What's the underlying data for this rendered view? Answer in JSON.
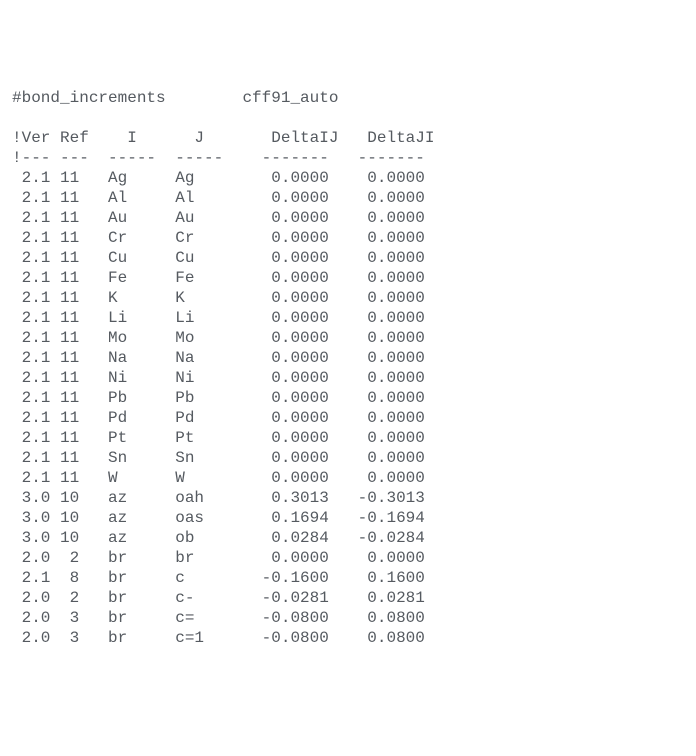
{
  "header": {
    "directive": "#bond_increments",
    "label": "cff91_auto"
  },
  "columns": {
    "ver": "!Ver",
    "ref": "Ref",
    "i": "I",
    "j": "J",
    "dij": "DeltaIJ",
    "dji": "DeltaJI"
  },
  "separators": {
    "ver": "!---",
    "ref": "---",
    "i": "-----",
    "j": "-----",
    "dij": "-------",
    "dji": "-------"
  },
  "rows": [
    {
      "ver": "2.1",
      "ref": "11",
      "i": "Ag",
      "j": "Ag",
      "dij": "0.0000",
      "dji": "0.0000"
    },
    {
      "ver": "2.1",
      "ref": "11",
      "i": "Al",
      "j": "Al",
      "dij": "0.0000",
      "dji": "0.0000"
    },
    {
      "ver": "2.1",
      "ref": "11",
      "i": "Au",
      "j": "Au",
      "dij": "0.0000",
      "dji": "0.0000"
    },
    {
      "ver": "2.1",
      "ref": "11",
      "i": "Cr",
      "j": "Cr",
      "dij": "0.0000",
      "dji": "0.0000"
    },
    {
      "ver": "2.1",
      "ref": "11",
      "i": "Cu",
      "j": "Cu",
      "dij": "0.0000",
      "dji": "0.0000"
    },
    {
      "ver": "2.1",
      "ref": "11",
      "i": "Fe",
      "j": "Fe",
      "dij": "0.0000",
      "dji": "0.0000"
    },
    {
      "ver": "2.1",
      "ref": "11",
      "i": "K",
      "j": "K",
      "dij": "0.0000",
      "dji": "0.0000"
    },
    {
      "ver": "2.1",
      "ref": "11",
      "i": "Li",
      "j": "Li",
      "dij": "0.0000",
      "dji": "0.0000"
    },
    {
      "ver": "2.1",
      "ref": "11",
      "i": "Mo",
      "j": "Mo",
      "dij": "0.0000",
      "dji": "0.0000"
    },
    {
      "ver": "2.1",
      "ref": "11",
      "i": "Na",
      "j": "Na",
      "dij": "0.0000",
      "dji": "0.0000"
    },
    {
      "ver": "2.1",
      "ref": "11",
      "i": "Ni",
      "j": "Ni",
      "dij": "0.0000",
      "dji": "0.0000"
    },
    {
      "ver": "2.1",
      "ref": "11",
      "i": "Pb",
      "j": "Pb",
      "dij": "0.0000",
      "dji": "0.0000"
    },
    {
      "ver": "2.1",
      "ref": "11",
      "i": "Pd",
      "j": "Pd",
      "dij": "0.0000",
      "dji": "0.0000"
    },
    {
      "ver": "2.1",
      "ref": "11",
      "i": "Pt",
      "j": "Pt",
      "dij": "0.0000",
      "dji": "0.0000"
    },
    {
      "ver": "2.1",
      "ref": "11",
      "i": "Sn",
      "j": "Sn",
      "dij": "0.0000",
      "dji": "0.0000"
    },
    {
      "ver": "2.1",
      "ref": "11",
      "i": "W",
      "j": "W",
      "dij": "0.0000",
      "dji": "0.0000"
    },
    {
      "ver": "3.0",
      "ref": "10",
      "i": "az",
      "j": "oah",
      "dij": "0.3013",
      "dji": "-0.3013"
    },
    {
      "ver": "3.0",
      "ref": "10",
      "i": "az",
      "j": "oas",
      "dij": "0.1694",
      "dji": "-0.1694"
    },
    {
      "ver": "3.0",
      "ref": "10",
      "i": "az",
      "j": "ob",
      "dij": "0.0284",
      "dji": "-0.0284"
    },
    {
      "ver": "2.0",
      "ref": "2",
      "i": "br",
      "j": "br",
      "dij": "0.0000",
      "dji": "0.0000"
    },
    {
      "ver": "2.1",
      "ref": "8",
      "i": "br",
      "j": "c",
      "dij": "-0.1600",
      "dji": "0.1600"
    },
    {
      "ver": "2.0",
      "ref": "2",
      "i": "br",
      "j": "c-",
      "dij": "-0.0281",
      "dji": "0.0281"
    },
    {
      "ver": "2.0",
      "ref": "3",
      "i": "br",
      "j": "c=",
      "dij": "-0.0800",
      "dji": "0.0800"
    },
    {
      "ver": "2.0",
      "ref": "3",
      "i": "br",
      "j": "c=1",
      "dij": "-0.0800",
      "dji": "0.0800"
    }
  ]
}
